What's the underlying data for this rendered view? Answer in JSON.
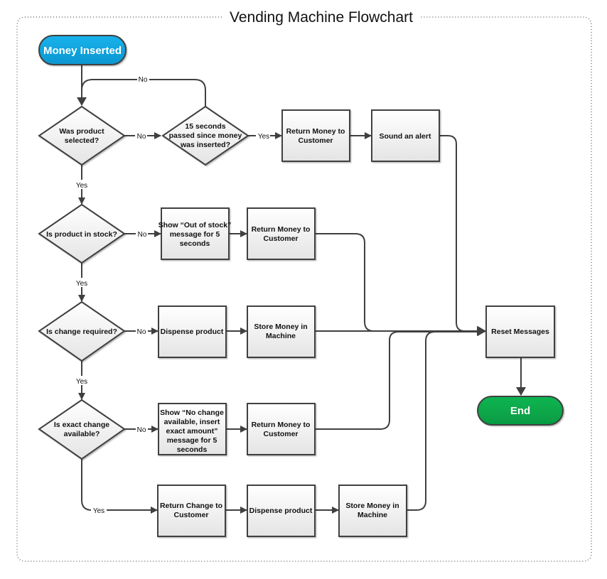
{
  "title": "Vending Machine Flowchart",
  "colors": {
    "start_fill": "#0ea5e0",
    "end_fill": "#08a84a",
    "stroke": "#404040",
    "box_fill_top": "#ffffff",
    "box_fill_bottom": "#e6e6e6",
    "border": "#555555"
  },
  "nodes": {
    "start": {
      "type": "terminal",
      "lines": [
        "Money Inserted"
      ]
    },
    "d_selected": {
      "type": "decision",
      "lines": [
        "Was product",
        "selected?"
      ]
    },
    "d_timeout": {
      "type": "decision",
      "lines": [
        "15 seconds",
        "passed since money",
        "was inserted?"
      ]
    },
    "p_return1": {
      "type": "process",
      "lines": [
        "Return Money to",
        "Customer"
      ]
    },
    "p_alert": {
      "type": "process",
      "lines": [
        "Sound an alert"
      ]
    },
    "d_stock": {
      "type": "decision",
      "lines": [
        "Is product in stock?"
      ]
    },
    "p_outofstock": {
      "type": "process",
      "lines": [
        "Show “Out of stock”",
        "message for 5",
        "seconds"
      ]
    },
    "p_return2": {
      "type": "process",
      "lines": [
        "Return Money to",
        "Customer"
      ]
    },
    "d_change": {
      "type": "decision",
      "lines": [
        "Is change required?"
      ]
    },
    "p_dispense1": {
      "type": "process",
      "lines": [
        "Dispense product"
      ]
    },
    "p_store1": {
      "type": "process",
      "lines": [
        "Store Money in",
        "Machine"
      ]
    },
    "d_exact": {
      "type": "decision",
      "lines": [
        "Is exact change",
        "available?"
      ]
    },
    "p_nochange": {
      "type": "process",
      "lines": [
        "Show “No change",
        "available, insert",
        "exact amount”",
        "message for 5",
        "seconds"
      ]
    },
    "p_return3": {
      "type": "process",
      "lines": [
        "Return Money to",
        "Customer"
      ]
    },
    "p_returnchange": {
      "type": "process",
      "lines": [
        "Return Change to",
        "Customer"
      ]
    },
    "p_dispense2": {
      "type": "process",
      "lines": [
        "Dispense product"
      ]
    },
    "p_store2": {
      "type": "process",
      "lines": [
        "Store Money in",
        "Machine"
      ]
    },
    "p_reset": {
      "type": "process",
      "lines": [
        "Reset Messages"
      ]
    },
    "end": {
      "type": "terminal",
      "lines": [
        "End"
      ]
    }
  },
  "edges": [
    {
      "from": "start",
      "to": "d_selected",
      "label": ""
    },
    {
      "from": "d_selected",
      "to": "d_timeout",
      "label": "No"
    },
    {
      "from": "d_timeout",
      "to": "d_selected",
      "label": "No"
    },
    {
      "from": "d_timeout",
      "to": "p_return1",
      "label": "Yes"
    },
    {
      "from": "p_return1",
      "to": "p_alert",
      "label": ""
    },
    {
      "from": "p_alert",
      "to": "p_reset",
      "label": ""
    },
    {
      "from": "d_selected",
      "to": "d_stock",
      "label": "Yes"
    },
    {
      "from": "d_stock",
      "to": "p_outofstock",
      "label": "No"
    },
    {
      "from": "p_outofstock",
      "to": "p_return2",
      "label": ""
    },
    {
      "from": "p_return2",
      "to": "p_reset",
      "label": ""
    },
    {
      "from": "d_stock",
      "to": "d_change",
      "label": "Yes"
    },
    {
      "from": "d_change",
      "to": "p_dispense1",
      "label": "No"
    },
    {
      "from": "p_dispense1",
      "to": "p_store1",
      "label": ""
    },
    {
      "from": "p_store1",
      "to": "p_reset",
      "label": ""
    },
    {
      "from": "d_change",
      "to": "d_exact",
      "label": "Yes"
    },
    {
      "from": "d_exact",
      "to": "p_nochange",
      "label": "No"
    },
    {
      "from": "p_nochange",
      "to": "p_return3",
      "label": ""
    },
    {
      "from": "p_return3",
      "to": "p_reset",
      "label": ""
    },
    {
      "from": "d_exact",
      "to": "p_returnchange",
      "label": "Yes"
    },
    {
      "from": "p_returnchange",
      "to": "p_dispense2",
      "label": ""
    },
    {
      "from": "p_dispense2",
      "to": "p_store2",
      "label": ""
    },
    {
      "from": "p_store2",
      "to": "p_reset",
      "label": ""
    },
    {
      "from": "p_reset",
      "to": "end",
      "label": ""
    }
  ]
}
